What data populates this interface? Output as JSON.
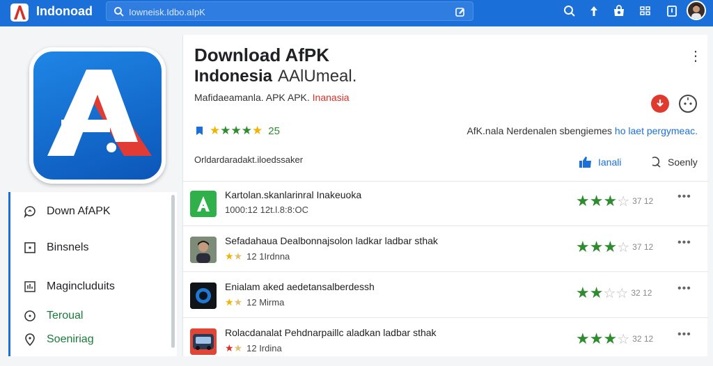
{
  "topbar": {
    "brand": "Indonoad",
    "search_value": "Iowneisk.Idbo.aIpK",
    "icons": [
      "search-icon",
      "upload-icon",
      "bag-icon",
      "grid-icon",
      "bookmark-icon",
      "avatar"
    ]
  },
  "app": {
    "title_line1": "Download AfPK",
    "title_line2": "Indonesia",
    "title_line2_sub": "AAlUmeal.",
    "developer_prefix": "Mafidaeamanla. APK APK.",
    "developer_highlight": "Inanasia",
    "rating_value": "25",
    "meta_text": "AfK.nala Nerdenalen sbengiemes",
    "meta_link": "ho laet pergymeac.",
    "tagline": "Orldardaradakt.iloedssaker",
    "action_primary": "Ianali",
    "action_secondary": "Soenly"
  },
  "sidebar": {
    "items": [
      {
        "label": "Down AfAPK",
        "icon": "chat-bubble-icon"
      },
      {
        "label": "Binsnels",
        "icon": "square-icon"
      },
      {
        "label": "Magincluduits",
        "icon": "chart-box-icon"
      },
      {
        "label": "Teroual",
        "icon": "clock-icon"
      },
      {
        "label": "Soeniriag",
        "icon": "location-icon"
      }
    ]
  },
  "reviews": [
    {
      "title": "Kartolan.skanlarinral Inakeuoka",
      "sub": "1000:12 12t.l.8:8:OC",
      "stars": 3,
      "score": "37 12",
      "thumb": "green-logo"
    },
    {
      "title": "Sefadahaua Dealbonnajsolon ladkar ladbar sthak",
      "sub": "12  1Irdnna",
      "sub_stars": 2,
      "stars": 3,
      "score": "37 12",
      "thumb": "person"
    },
    {
      "title": "Enialam aked aedetansalberdessh",
      "sub": "12  Mirma",
      "sub_stars": 2,
      "stars": 2,
      "score": "32 12",
      "thumb": "dark-app"
    },
    {
      "title": "Rolacdanalat Pehdnarpaillc aladkan ladbar sthak",
      "sub": "12  Irdina",
      "sub_stars": 2,
      "stars": 3,
      "score": "32 12",
      "thumb": "car"
    }
  ],
  "colors": {
    "accent": "#1a6fd8",
    "green": "#2e8b2e",
    "red": "#d93025",
    "star": "#f2b400"
  }
}
